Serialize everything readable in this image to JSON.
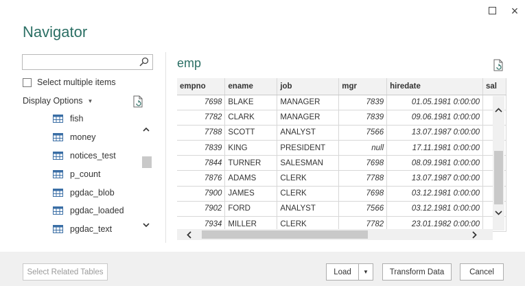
{
  "window": {
    "title": "Navigator",
    "restore_label": "",
    "close_label": "×"
  },
  "left_panel": {
    "search": {
      "value": "",
      "placeholder": ""
    },
    "select_multiple_label": "Select multiple items",
    "display_options_label": "Display Options",
    "items": [
      {
        "label": "fish"
      },
      {
        "label": "money"
      },
      {
        "label": "notices_test"
      },
      {
        "label": "p_count"
      },
      {
        "label": "pgdac_blob"
      },
      {
        "label": "pgdac_loaded"
      },
      {
        "label": "pgdac_text"
      }
    ]
  },
  "preview": {
    "title": "emp",
    "columns": [
      "empno",
      "ename",
      "job",
      "mgr",
      "hiredate",
      "sal"
    ],
    "rows": [
      [
        "7698",
        "BLAKE",
        "MANAGER",
        "7839",
        "01.05.1981 0:00:00",
        ""
      ],
      [
        "7782",
        "CLARK",
        "MANAGER",
        "7839",
        "09.06.1981 0:00:00",
        ""
      ],
      [
        "7788",
        "SCOTT",
        "ANALYST",
        "7566",
        "13.07.1987 0:00:00",
        ""
      ],
      [
        "7839",
        "KING",
        "PRESIDENT",
        "null",
        "17.11.1981 0:00:00",
        ""
      ],
      [
        "7844",
        "TURNER",
        "SALESMAN",
        "7698",
        "08.09.1981 0:00:00",
        ""
      ],
      [
        "7876",
        "ADAMS",
        "CLERK",
        "7788",
        "13.07.1987 0:00:00",
        ""
      ],
      [
        "7900",
        "JAMES",
        "CLERK",
        "7698",
        "03.12.1981 0:00:00",
        ""
      ],
      [
        "7902",
        "FORD",
        "ANALYST",
        "7566",
        "03.12.1981 0:00:00",
        ""
      ],
      [
        "7934",
        "MILLER",
        "CLERK",
        "7782",
        "23.01.1982 0:00:00",
        ""
      ]
    ]
  },
  "footer": {
    "select_related_label": "Select Related Tables",
    "load_label": "Load",
    "transform_label": "Transform Data",
    "cancel_label": "Cancel"
  },
  "colors": {
    "accent": "#2b6f64",
    "footer_bg": "#f0f0f0",
    "header_bg": "#f2f2f2"
  }
}
